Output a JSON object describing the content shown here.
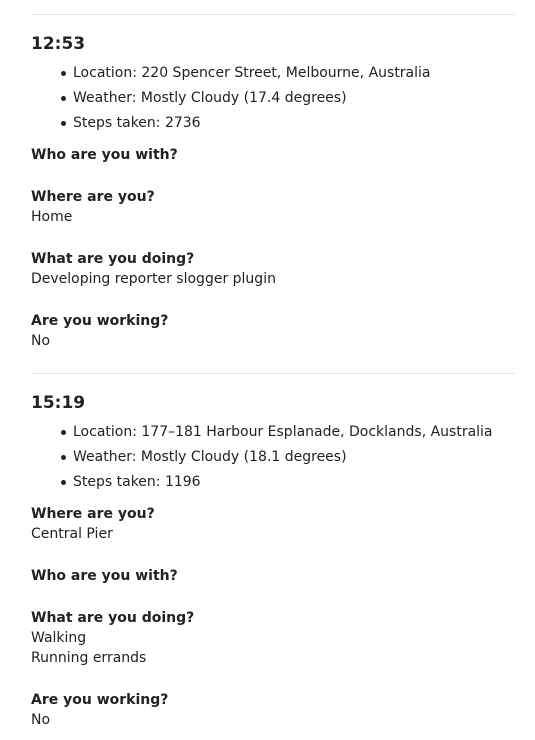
{
  "entries": [
    {
      "time": "12:53",
      "details": [
        "Location: 220 Spencer Street, Melbourne, Australia",
        "Weather: Mostly Cloudy (17.4 degrees)",
        "Steps taken: 2736"
      ],
      "qa": [
        {
          "question": "Who are you with?",
          "answers": []
        },
        {
          "question": "Where are you?",
          "answers": [
            "Home"
          ]
        },
        {
          "question": "What are you doing?",
          "answers": [
            "Developing reporter slogger plugin"
          ]
        },
        {
          "question": "Are you working?",
          "answers": [
            "No"
          ]
        }
      ]
    },
    {
      "time": "15:19",
      "details": [
        "Location: 177–181 Harbour Esplanade, Docklands, Australia",
        "Weather: Mostly Cloudy (18.1 degrees)",
        "Steps taken: 1196"
      ],
      "qa": [
        {
          "question": "Where are you?",
          "answers": [
            "Central Pier"
          ]
        },
        {
          "question": "Who are you with?",
          "answers": []
        },
        {
          "question": "What are you doing?",
          "answers": [
            "Walking",
            "Running errands"
          ]
        },
        {
          "question": "Are you working?",
          "answers": [
            "No"
          ]
        }
      ]
    }
  ]
}
